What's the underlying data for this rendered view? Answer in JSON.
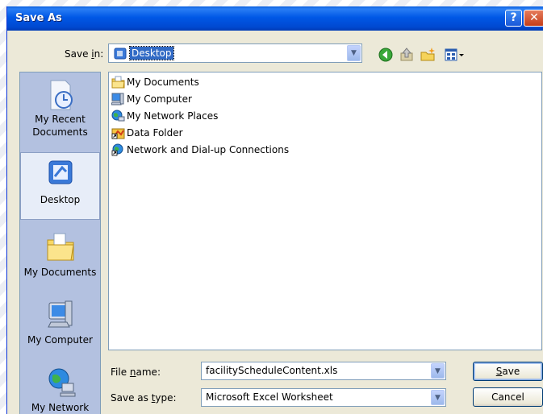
{
  "window": {
    "title": "Save As",
    "help_glyph": "?",
    "close_glyph": "✕"
  },
  "save_in": {
    "label_pre": "Save ",
    "label_key": "i",
    "label_post": "n:",
    "value": "Desktop"
  },
  "toolbar": {
    "icons": [
      "back-icon",
      "up-folder-icon",
      "new-folder-icon",
      "views-menu-icon"
    ]
  },
  "places": [
    {
      "label_line1": "My Recent",
      "label_line2": "Documents",
      "icon": "recent-documents-icon"
    },
    {
      "label_line1": "Desktop",
      "label_line2": "",
      "icon": "desktop-icon"
    },
    {
      "label_line1": "My Documents",
      "label_line2": "",
      "icon": "my-documents-icon"
    },
    {
      "label_line1": "My Computer",
      "label_line2": "",
      "icon": "my-computer-icon"
    },
    {
      "label_line1": "My Network",
      "label_line2": "",
      "icon": "my-network-icon"
    }
  ],
  "files": [
    {
      "name": "My Documents",
      "icon": "my-documents-icon"
    },
    {
      "name": "My Computer",
      "icon": "my-computer-icon"
    },
    {
      "name": "My Network Places",
      "icon": "network-places-icon"
    },
    {
      "name": "Data Folder",
      "icon": "shortcut-icon"
    },
    {
      "name": "Network and Dial-up Connections",
      "icon": "network-connections-icon"
    }
  ],
  "file_name": {
    "label_pre": "File ",
    "label_key": "n",
    "label_post": "ame:",
    "value": "facilityScheduleContent.xls"
  },
  "save_as_type": {
    "label_pre": "Save as ",
    "label_key": "t",
    "label_post": "ype:",
    "value": "Microsoft Excel Worksheet"
  },
  "buttons": {
    "save_key": "S",
    "save_rest": "ave",
    "cancel": "Cancel"
  },
  "colors": {
    "titlebar": "#0058e6",
    "selection": "#316ac5",
    "dialog_bg": "#ece9d8",
    "places_bg": "#b3c1e0"
  }
}
